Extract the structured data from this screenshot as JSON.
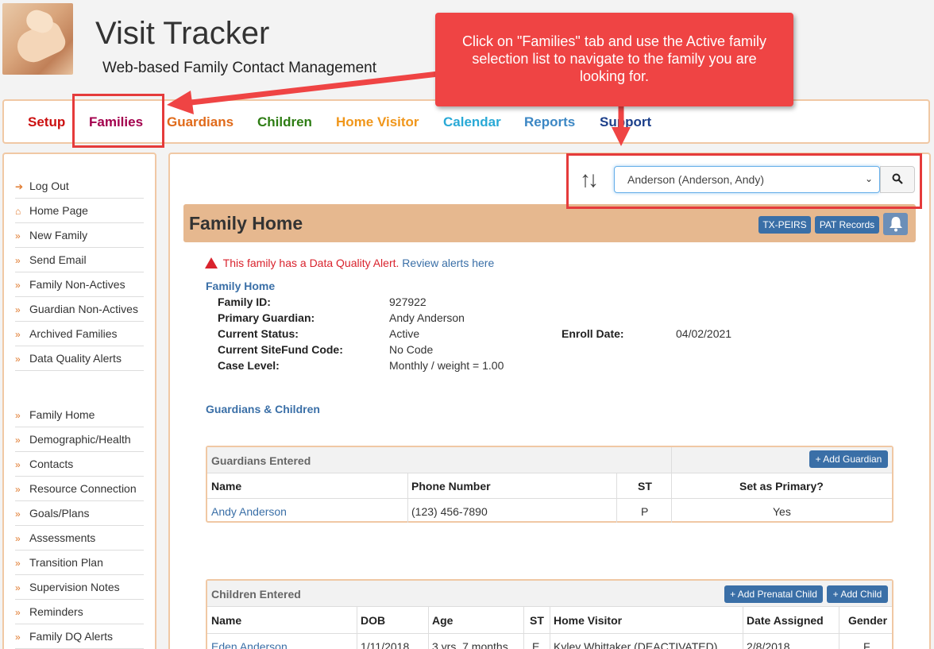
{
  "header": {
    "app_title": "Visit Tracker",
    "app_subtitle": "Web-based Family Contact Management"
  },
  "topnav": {
    "tabs": [
      {
        "label": "Setup",
        "color": "#cc1111"
      },
      {
        "label": "Families",
        "color": "#a3004d"
      },
      {
        "label": "Guardians",
        "color": "#e06a1a"
      },
      {
        "label": "Children",
        "color": "#2e7d14"
      },
      {
        "label": "Home Visitor",
        "color": "#f0961a"
      },
      {
        "label": "Calendar",
        "color": "#29a9d6"
      },
      {
        "label": "Reports",
        "color": "#3c87c4"
      },
      {
        "label": "Support",
        "color": "#1c3f8a"
      }
    ]
  },
  "sidebar": {
    "group1": [
      {
        "label": "Log Out",
        "icon": "sign-out-icon"
      },
      {
        "label": "Home Page",
        "icon": "home-icon"
      },
      {
        "label": "New Family",
        "icon": "double-chevron-icon"
      },
      {
        "label": "Send Email",
        "icon": "double-chevron-icon"
      },
      {
        "label": "Family Non-Actives",
        "icon": "double-chevron-icon"
      },
      {
        "label": "Guardian Non-Actives",
        "icon": "double-chevron-icon"
      },
      {
        "label": "Archived Families",
        "icon": "double-chevron-icon"
      },
      {
        "label": "Data Quality Alerts",
        "icon": "double-chevron-icon"
      }
    ],
    "group2": [
      {
        "label": "Family Home",
        "icon": "double-chevron-icon"
      },
      {
        "label": "Demographic/Health",
        "icon": "double-chevron-icon"
      },
      {
        "label": "Contacts",
        "icon": "double-chevron-icon"
      },
      {
        "label": "Resource Connection",
        "icon": "double-chevron-icon"
      },
      {
        "label": "Goals/Plans",
        "icon": "double-chevron-icon"
      },
      {
        "label": "Assessments",
        "icon": "double-chevron-icon"
      },
      {
        "label": "Transition Plan",
        "icon": "double-chevron-icon"
      },
      {
        "label": "Supervision Notes",
        "icon": "double-chevron-icon"
      },
      {
        "label": "Reminders",
        "icon": "double-chevron-icon"
      },
      {
        "label": "Family DQ Alerts",
        "icon": "double-chevron-icon"
      }
    ]
  },
  "family_select": {
    "selected": "Anderson (Anderson, Andy)"
  },
  "family_home": {
    "title": "Family Home",
    "buttons": {
      "tx_peirs": "TX-PEIRS",
      "pat_records": "PAT Records"
    },
    "alert_text": "This family has a Data Quality Alert.",
    "alert_link": "Review alerts here",
    "section_title": "Family Home",
    "fields": [
      {
        "label": "Family ID:",
        "value": "927922"
      },
      {
        "label": "Primary Guardian:",
        "value": "Andy Anderson"
      },
      {
        "label": "Current Status:",
        "value": "Active"
      },
      {
        "label": "Current SiteFund Code:",
        "value": "No Code"
      },
      {
        "label": "Case Level:",
        "value": "Monthly / weight = 1.00"
      }
    ],
    "enroll_label": "Enroll Date:",
    "enroll_value": "04/02/2021",
    "guardians_children_title": "Guardians & Children"
  },
  "guardians_panel": {
    "title": "Guardians Entered",
    "add_button": "+ Add Guardian",
    "columns": [
      "Name",
      "Phone Number",
      "ST",
      "Set as Primary?"
    ],
    "rows": [
      {
        "name": "Andy Anderson",
        "phone": "(123) 456-7890",
        "st": "P",
        "primary": "Yes"
      }
    ]
  },
  "children_panel": {
    "title": "Children Entered",
    "add_prenatal_button": "+ Add Prenatal Child",
    "add_child_button": "+ Add Child",
    "columns": [
      "Name",
      "DOB",
      "Age",
      "ST",
      "Home Visitor",
      "Date Assigned",
      "Gender"
    ],
    "rows": [
      {
        "name": "Eden Anderson",
        "dob": "1/11/2018",
        "age": "3 yrs, 7 months",
        "st": "E",
        "visitor": "Kyley Whittaker (DEACTIVATED)",
        "assigned": "2/8/2018",
        "gender": "F"
      }
    ]
  },
  "callout": {
    "text": "Click on \"Families\" tab and use the Active family selection list to navigate to the family you are looking for."
  }
}
